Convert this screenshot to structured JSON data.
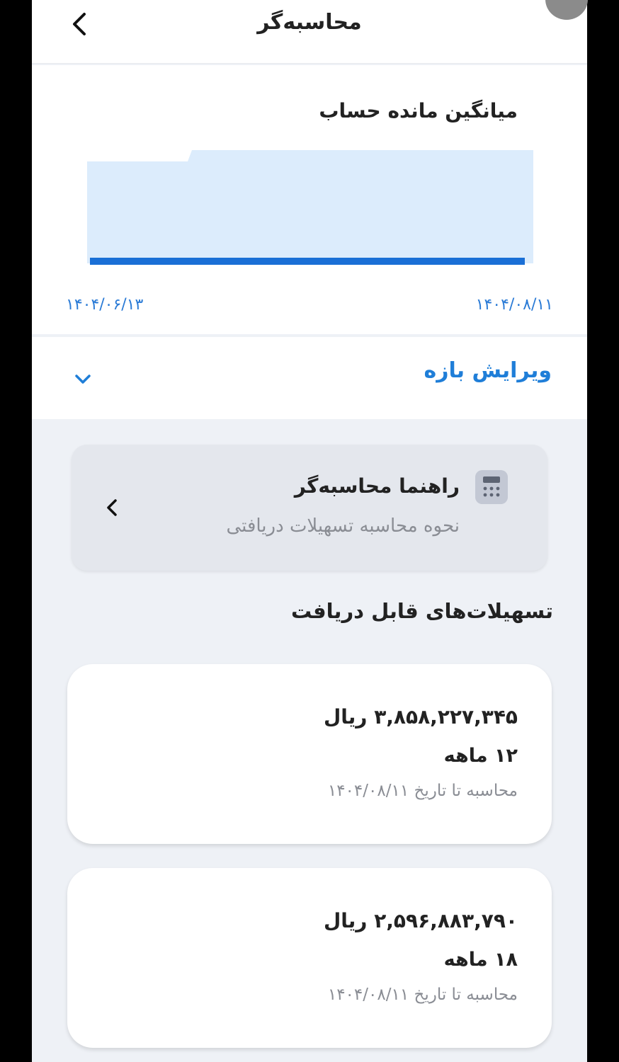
{
  "header": {
    "title": "محاسبه‌گر"
  },
  "chart_data": {
    "type": "area",
    "title": "میانگین مانده حساب",
    "x_labels": [
      "۱۴۰۴/۰۶/۱۳",
      "۱۴۰۴/۰۸/۱۱"
    ],
    "x": [
      "۱۴۰۴/۰۶/۱۳",
      "۱۴۰۴/۰۸/۱۱"
    ],
    "series": [
      {
        "values": [
          0.9,
          1.0
        ]
      }
    ],
    "xlabel": "",
    "ylabel": "",
    "grid": false,
    "colors": {
      "fill": "#dcecfc",
      "line": "#1a6fd6"
    }
  },
  "range": {
    "label": "ویرایش بازه"
  },
  "guide": {
    "title": "راهنما محاسبه‌گر",
    "subtitle": "نحوه محاسبه تسهیلات دریافتی"
  },
  "loans_section": {
    "title": "تسهیلات‌های قابل دریافت"
  },
  "loans": [
    {
      "amount": "۳,۸۵۸,۲۲۷,۳۴۵ ریال",
      "term": "۱۲ ماهه",
      "as_of": "محاسبه تا تاریخ ۱۴۰۴/۰۸/۱۱"
    },
    {
      "amount": "۲,۵۹۶,۸۸۳,۷۹۰ ریال",
      "term": "۱۸ ماهه",
      "as_of": "محاسبه تا تاریخ ۱۴۰۴/۰۸/۱۱"
    }
  ],
  "colors": {
    "accent": "#1f7ed8",
    "page_background": "#eef1f6",
    "card": "#ffffff"
  }
}
